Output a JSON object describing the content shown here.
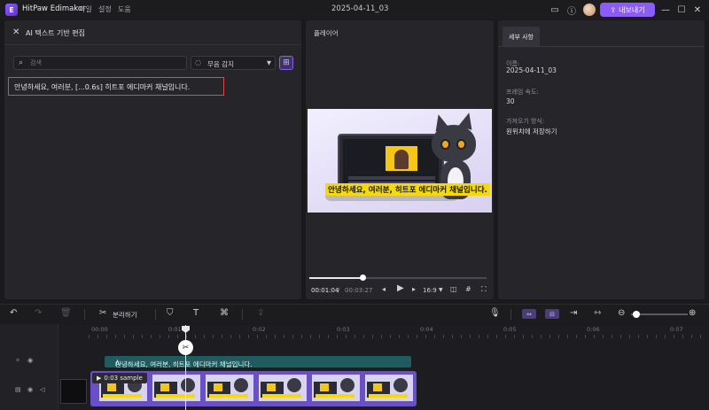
{
  "app": {
    "name": "HitPaw Edimakor",
    "logo_letter": "E",
    "accent": "#8b5cf6"
  },
  "menu": [
    "파일",
    "설정",
    "도움"
  ],
  "document_title": "2025-04-11_03",
  "titlebar": {
    "export_label": "내보내기"
  },
  "left_panel": {
    "title": "AI 텍스트 기반 편집",
    "search_placeholder": "검색",
    "silence_option": "무음 감지",
    "transcript_line": "안녕하세요, 여러분, [...0.6s] 히트포 에디마커 채널입니다."
  },
  "player": {
    "title": "플레이어",
    "subtitle_text": "안녕하세요, 여러분, 히트포 에디마커 채널입니다.",
    "current_time": "00:01:04",
    "separator": "/",
    "total_time": "00:03:27",
    "aspect_ratio": "16:9",
    "progress": 0.3
  },
  "details": {
    "tab": "세부 사항",
    "name_label": "이름:",
    "name_value": "2025-04-11_03",
    "fps_label": "프레임 속도:",
    "fps_value": "30",
    "import_label": "가져오기 방식:",
    "import_value": "원위치에 저장하기"
  },
  "toolbar": {
    "split_label": "분리하기",
    "zoom_level": 0.05
  },
  "timeline": {
    "ruler": [
      "00:00",
      "0:01",
      "0:02",
      "0:03",
      "0:04",
      "0:05",
      "0:06",
      "0:07"
    ],
    "caption_text": "안녕하세요, 여러분, 히트포 에디마커 채널입니다.",
    "caption_prefix": "Ȧ",
    "clip_label": "0:03 sample"
  }
}
